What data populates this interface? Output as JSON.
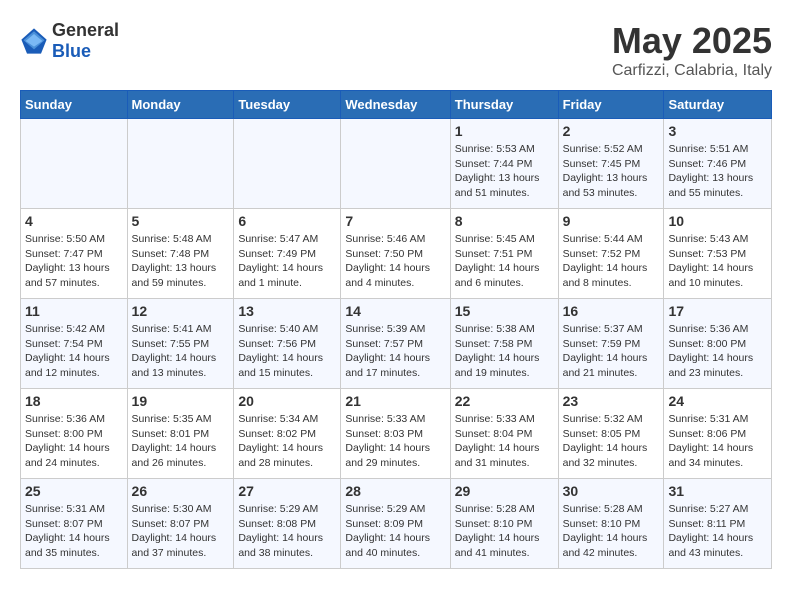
{
  "logo": {
    "general": "General",
    "blue": "Blue"
  },
  "title": "May 2025",
  "subtitle": "Carfizzi, Calabria, Italy",
  "days_of_week": [
    "Sunday",
    "Monday",
    "Tuesday",
    "Wednesday",
    "Thursday",
    "Friday",
    "Saturday"
  ],
  "weeks": [
    [
      {
        "day": "",
        "content": ""
      },
      {
        "day": "",
        "content": ""
      },
      {
        "day": "",
        "content": ""
      },
      {
        "day": "",
        "content": ""
      },
      {
        "day": "1",
        "content": "Sunrise: 5:53 AM\nSunset: 7:44 PM\nDaylight: 13 hours\nand 51 minutes."
      },
      {
        "day": "2",
        "content": "Sunrise: 5:52 AM\nSunset: 7:45 PM\nDaylight: 13 hours\nand 53 minutes."
      },
      {
        "day": "3",
        "content": "Sunrise: 5:51 AM\nSunset: 7:46 PM\nDaylight: 13 hours\nand 55 minutes."
      }
    ],
    [
      {
        "day": "4",
        "content": "Sunrise: 5:50 AM\nSunset: 7:47 PM\nDaylight: 13 hours\nand 57 minutes."
      },
      {
        "day": "5",
        "content": "Sunrise: 5:48 AM\nSunset: 7:48 PM\nDaylight: 13 hours\nand 59 minutes."
      },
      {
        "day": "6",
        "content": "Sunrise: 5:47 AM\nSunset: 7:49 PM\nDaylight: 14 hours\nand 1 minute."
      },
      {
        "day": "7",
        "content": "Sunrise: 5:46 AM\nSunset: 7:50 PM\nDaylight: 14 hours\nand 4 minutes."
      },
      {
        "day": "8",
        "content": "Sunrise: 5:45 AM\nSunset: 7:51 PM\nDaylight: 14 hours\nand 6 minutes."
      },
      {
        "day": "9",
        "content": "Sunrise: 5:44 AM\nSunset: 7:52 PM\nDaylight: 14 hours\nand 8 minutes."
      },
      {
        "day": "10",
        "content": "Sunrise: 5:43 AM\nSunset: 7:53 PM\nDaylight: 14 hours\nand 10 minutes."
      }
    ],
    [
      {
        "day": "11",
        "content": "Sunrise: 5:42 AM\nSunset: 7:54 PM\nDaylight: 14 hours\nand 12 minutes."
      },
      {
        "day": "12",
        "content": "Sunrise: 5:41 AM\nSunset: 7:55 PM\nDaylight: 14 hours\nand 13 minutes."
      },
      {
        "day": "13",
        "content": "Sunrise: 5:40 AM\nSunset: 7:56 PM\nDaylight: 14 hours\nand 15 minutes."
      },
      {
        "day": "14",
        "content": "Sunrise: 5:39 AM\nSunset: 7:57 PM\nDaylight: 14 hours\nand 17 minutes."
      },
      {
        "day": "15",
        "content": "Sunrise: 5:38 AM\nSunset: 7:58 PM\nDaylight: 14 hours\nand 19 minutes."
      },
      {
        "day": "16",
        "content": "Sunrise: 5:37 AM\nSunset: 7:59 PM\nDaylight: 14 hours\nand 21 minutes."
      },
      {
        "day": "17",
        "content": "Sunrise: 5:36 AM\nSunset: 8:00 PM\nDaylight: 14 hours\nand 23 minutes."
      }
    ],
    [
      {
        "day": "18",
        "content": "Sunrise: 5:36 AM\nSunset: 8:00 PM\nDaylight: 14 hours\nand 24 minutes."
      },
      {
        "day": "19",
        "content": "Sunrise: 5:35 AM\nSunset: 8:01 PM\nDaylight: 14 hours\nand 26 minutes."
      },
      {
        "day": "20",
        "content": "Sunrise: 5:34 AM\nSunset: 8:02 PM\nDaylight: 14 hours\nand 28 minutes."
      },
      {
        "day": "21",
        "content": "Sunrise: 5:33 AM\nSunset: 8:03 PM\nDaylight: 14 hours\nand 29 minutes."
      },
      {
        "day": "22",
        "content": "Sunrise: 5:33 AM\nSunset: 8:04 PM\nDaylight: 14 hours\nand 31 minutes."
      },
      {
        "day": "23",
        "content": "Sunrise: 5:32 AM\nSunset: 8:05 PM\nDaylight: 14 hours\nand 32 minutes."
      },
      {
        "day": "24",
        "content": "Sunrise: 5:31 AM\nSunset: 8:06 PM\nDaylight: 14 hours\nand 34 minutes."
      }
    ],
    [
      {
        "day": "25",
        "content": "Sunrise: 5:31 AM\nSunset: 8:07 PM\nDaylight: 14 hours\nand 35 minutes."
      },
      {
        "day": "26",
        "content": "Sunrise: 5:30 AM\nSunset: 8:07 PM\nDaylight: 14 hours\nand 37 minutes."
      },
      {
        "day": "27",
        "content": "Sunrise: 5:29 AM\nSunset: 8:08 PM\nDaylight: 14 hours\nand 38 minutes."
      },
      {
        "day": "28",
        "content": "Sunrise: 5:29 AM\nSunset: 8:09 PM\nDaylight: 14 hours\nand 40 minutes."
      },
      {
        "day": "29",
        "content": "Sunrise: 5:28 AM\nSunset: 8:10 PM\nDaylight: 14 hours\nand 41 minutes."
      },
      {
        "day": "30",
        "content": "Sunrise: 5:28 AM\nSunset: 8:10 PM\nDaylight: 14 hours\nand 42 minutes."
      },
      {
        "day": "31",
        "content": "Sunrise: 5:27 AM\nSunset: 8:11 PM\nDaylight: 14 hours\nand 43 minutes."
      }
    ]
  ]
}
